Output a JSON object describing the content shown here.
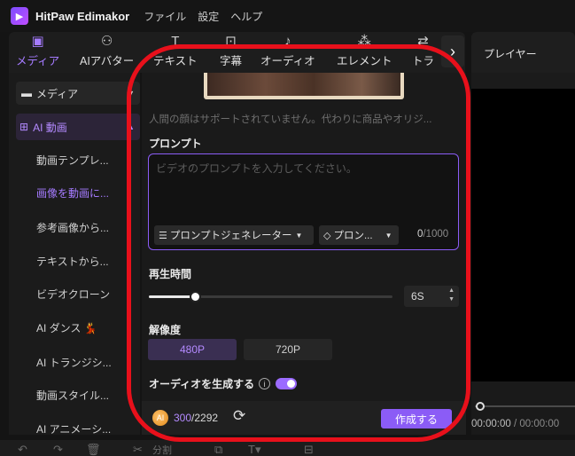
{
  "app": {
    "name": "HitPaw Edimakor",
    "menus": [
      "ファイル",
      "設定",
      "ヘルプ"
    ]
  },
  "tool_tabs": [
    {
      "label": "メディア",
      "icon": "media-icon",
      "active": true
    },
    {
      "label": "AIアバター",
      "icon": "avatar-icon",
      "active": false
    },
    {
      "label": "テキスト",
      "icon": "text-icon",
      "active": false
    },
    {
      "label": "字幕",
      "icon": "subtitle-icon",
      "active": false
    },
    {
      "label": "オーディオ",
      "icon": "audio-icon",
      "active": false
    },
    {
      "label": "エレメント",
      "icon": "element-icon",
      "active": false
    },
    {
      "label": "トラ",
      "icon": "transition-icon",
      "active": false
    }
  ],
  "sidebar": {
    "media_dropdown": "メディア",
    "ai_section": "AI 動画",
    "items": [
      {
        "label": "動画テンプレ...",
        "active": false
      },
      {
        "label": "画像を動画に...",
        "active": true
      },
      {
        "label": "参考画像から...",
        "active": false
      },
      {
        "label": "テキストから...",
        "active": false
      },
      {
        "label": "ビデオクローン",
        "active": false
      },
      {
        "label": "AI ダンス 💃",
        "active": false
      },
      {
        "label": "AI トランジシ...",
        "active": false
      },
      {
        "label": "動画スタイル...",
        "active": false
      },
      {
        "label": "AI アニメーシ...",
        "active": false
      }
    ]
  },
  "panel": {
    "notice": "人間の顔はサポートされていません。代わりに商品やオリジ...",
    "prompt_label": "プロンプト",
    "prompt_placeholder": "ビデオのプロンプトを入力してください。",
    "prompt_generator": "プロンプトジェネレーター",
    "prompt_preset": "プロン...",
    "char_count": "0",
    "char_max": "/1000",
    "duration_label": "再生時間",
    "duration_value": "6S",
    "duration_slider_fraction": 0.19,
    "resolution_label": "解像度",
    "resolutions": [
      "480P",
      "720P"
    ],
    "selected_resolution": "480P",
    "audio_label": "オーディオを生成する",
    "audio_enabled": true,
    "credits_used": "300",
    "credits_total": "/2292",
    "create_button": "作成する"
  },
  "player": {
    "title": "プレイヤー",
    "time_current": "00:00:00",
    "time_sep": " / ",
    "time_total": "00:00:00"
  },
  "bottombar": {
    "split_label": "分割"
  },
  "colors": {
    "accent": "#8b5cf6",
    "accent_text": "#b48aff",
    "annotation": "#e8101b"
  }
}
